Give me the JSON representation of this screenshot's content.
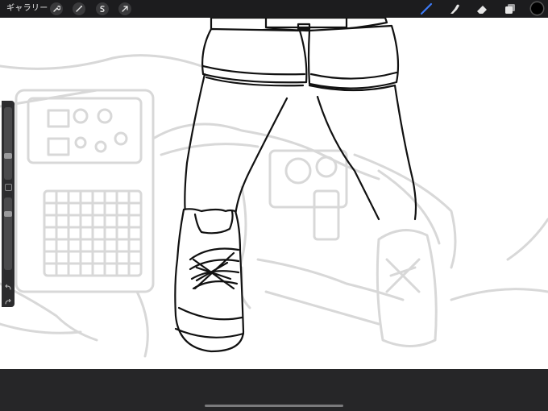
{
  "toolbar": {
    "gallery_label": "ギャラリー",
    "left_tools": [
      "wrench-icon",
      "magic-wand-icon",
      "selection-s-icon",
      "transform-arrow-icon"
    ],
    "right_tools": [
      "brush-icon",
      "smudge-icon",
      "eraser-icon",
      "layers-icon"
    ],
    "active_tool": "brush-icon",
    "accent_color": "#3d7bf7",
    "current_color": "#000000"
  },
  "sidebar": {
    "brush_size_level": 0.45,
    "opacity_level": 0.85,
    "undo_icon": "undo-icon",
    "redo_icon": "redo-icon"
  },
  "canvas": {
    "line_color": "#111111",
    "sketch_color": "#d8d8d8",
    "background": "#ffffff"
  }
}
